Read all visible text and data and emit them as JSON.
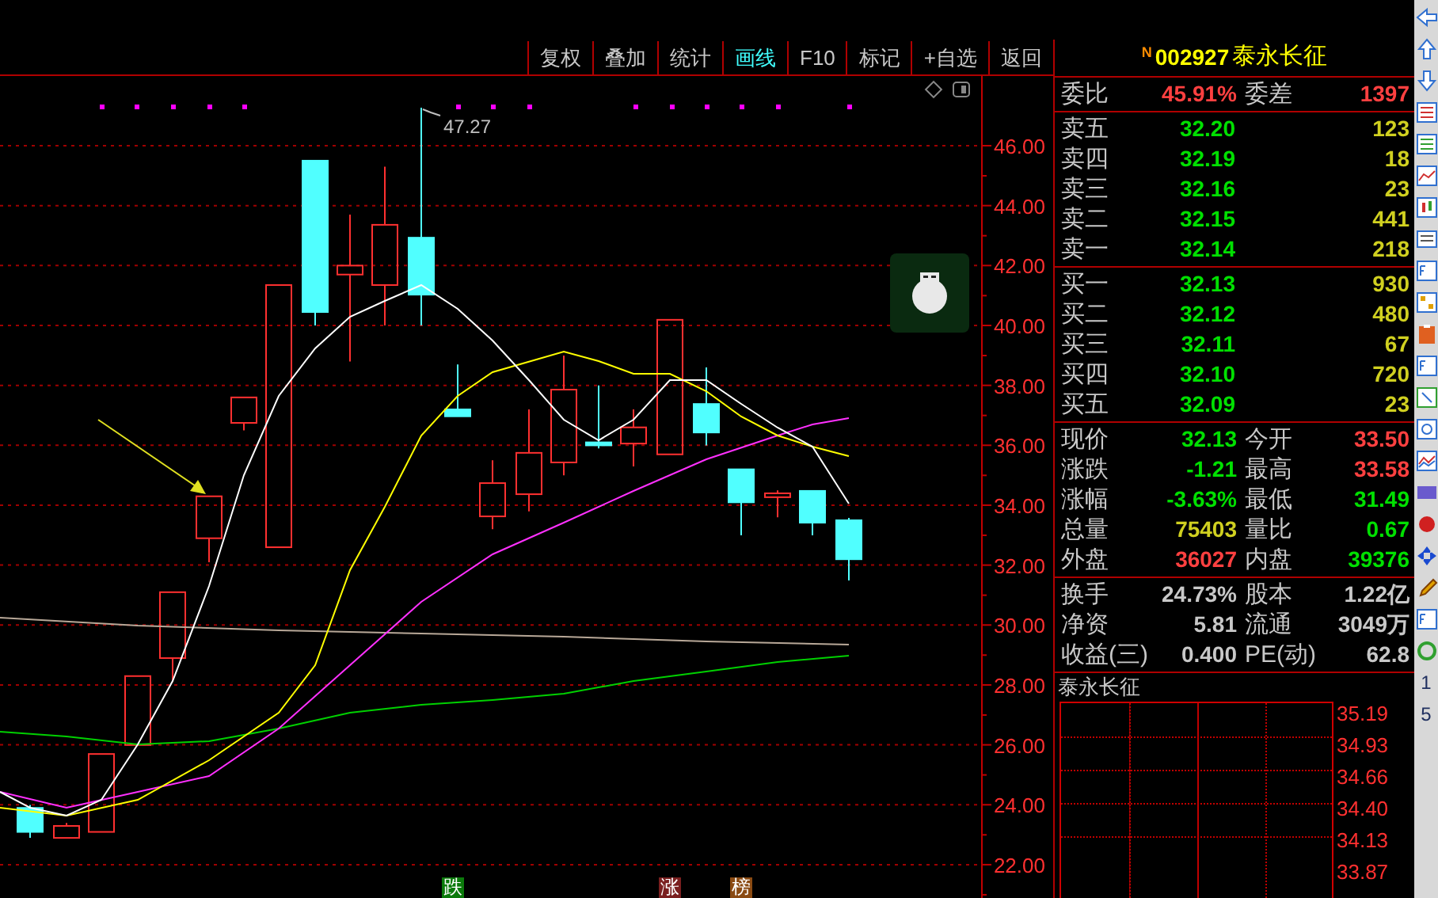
{
  "toolbar": {
    "buttons": [
      {
        "label": "复权",
        "selected": false
      },
      {
        "label": "叠加",
        "selected": false
      },
      {
        "label": "统计",
        "selected": false
      },
      {
        "label": "画线",
        "selected": true
      },
      {
        "label": "F10",
        "selected": false
      },
      {
        "label": "标记",
        "selected": false
      },
      {
        "label": "+自选",
        "selected": false
      },
      {
        "label": "返回",
        "selected": false
      }
    ]
  },
  "chart": {
    "axis_labels": [
      "46.00",
      "44.00",
      "42.00",
      "40.00",
      "38.00",
      "36.00",
      "34.00",
      "32.00",
      "30.00",
      "28.00",
      "26.00",
      "24.00",
      "22.00"
    ],
    "high_annotation": "47.27",
    "markers": [
      {
        "label": "跌",
        "color": "#0b7a0b"
      },
      {
        "label": "涨",
        "color": "#7a1f1f"
      },
      {
        "label": "榜",
        "color": "#8a4a12"
      }
    ]
  },
  "quote": {
    "badge": "N",
    "code": "002927",
    "name": "泰永长征"
  },
  "order_ratio": [
    {
      "label": "委比",
      "value": "45.91%",
      "color": "#ff4040"
    },
    {
      "label": "委差",
      "value": "1397",
      "color": "#ff4040"
    }
  ],
  "sell_levels": [
    {
      "label": "卖五",
      "price": "32.20",
      "volume": "123"
    },
    {
      "label": "卖四",
      "price": "32.19",
      "volume": "18"
    },
    {
      "label": "卖三",
      "price": "32.16",
      "volume": "23"
    },
    {
      "label": "卖二",
      "price": "32.15",
      "volume": "441"
    },
    {
      "label": "卖一",
      "price": "32.14",
      "volume": "218"
    }
  ],
  "buy_levels": [
    {
      "label": "买一",
      "price": "32.13",
      "volume": "930"
    },
    {
      "label": "买二",
      "price": "32.12",
      "volume": "480"
    },
    {
      "label": "买三",
      "price": "32.11",
      "volume": "67"
    },
    {
      "label": "买四",
      "price": "32.10",
      "volume": "720"
    },
    {
      "label": "买五",
      "price": "32.09",
      "volume": "23"
    }
  ],
  "stats": [
    {
      "label": "现价",
      "value": "32.13",
      "color": "#00e000"
    },
    {
      "label": "今开",
      "value": "33.50",
      "color": "#ff4040"
    },
    {
      "label": "涨跌",
      "value": "-1.21",
      "color": "#00e000"
    },
    {
      "label": "最高",
      "value": "33.58",
      "color": "#ff4040"
    },
    {
      "label": "涨幅",
      "value": "-3.63%",
      "color": "#00e000"
    },
    {
      "label": "最低",
      "value": "31.49",
      "color": "#00e000"
    },
    {
      "label": "总量",
      "value": "75403",
      "color": "#d0d020"
    },
    {
      "label": "量比",
      "value": "0.67",
      "color": "#00e000"
    },
    {
      "label": "外盘",
      "value": "36027",
      "color": "#ff4040"
    },
    {
      "label": "内盘",
      "value": "39376",
      "color": "#00e000"
    }
  ],
  "fundamentals": [
    {
      "label": "换手",
      "value": "24.73%"
    },
    {
      "label": "股本",
      "value": "1.22亿"
    },
    {
      "label": "净资",
      "value": "5.81"
    },
    {
      "label": "流通",
      "value": "3049万"
    },
    {
      "label": "收益(三)",
      "value": "0.400"
    },
    {
      "label": "PE(动)",
      "value": "62.8"
    }
  ],
  "mini_chart": {
    "title": "泰永长征",
    "axis_labels": [
      "35.19",
      "34.93",
      "34.66",
      "34.40",
      "34.13",
      "33.87"
    ]
  },
  "side_strip": {
    "texts": [
      "1",
      "5"
    ]
  }
}
